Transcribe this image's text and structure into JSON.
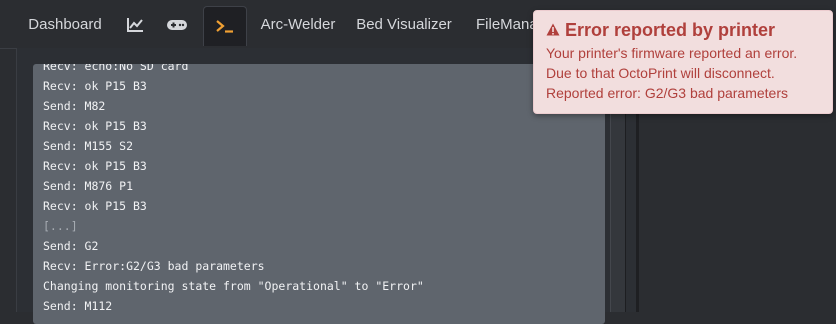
{
  "tabs": [
    {
      "label": "Dashboard"
    },
    {
      "icon": "line-chart-icon"
    },
    {
      "icon": "gamepad-icon"
    },
    {
      "icon": "terminal-icon",
      "active": true
    },
    {
      "label": "Arc-Welder"
    },
    {
      "label": "Bed Visualizer"
    },
    {
      "label": "FileManager"
    }
  ],
  "terminal": {
    "lines": [
      "Recv: echo:No SD card",
      "Recv: ok P15 B3",
      "Send: M82",
      "Recv: ok P15 B3",
      "Send: M155 S2",
      "Recv: ok P15 B3",
      "Send: M876 P1",
      "Recv: ok P15 B3",
      "[...]",
      "Send: G2",
      "Recv: Error:G2/G3 bad parameters",
      "Changing monitoring state from \"Operational\" to \"Error\"",
      "Send: M112"
    ]
  },
  "notification": {
    "title": "Error reported by printer",
    "line1": "Your printer's firmware reported an error.",
    "line2": "Due to that OctoPrint will disconnect.",
    "line3": "Reported error: G2/G3 bad parameters",
    "icon": "warning-icon",
    "color": "#b0403c",
    "background": "#f2dede"
  },
  "colors": {
    "accent": "#f0a033",
    "terminal_bg": "#5f656d",
    "page_bg": "#2b2d31"
  }
}
